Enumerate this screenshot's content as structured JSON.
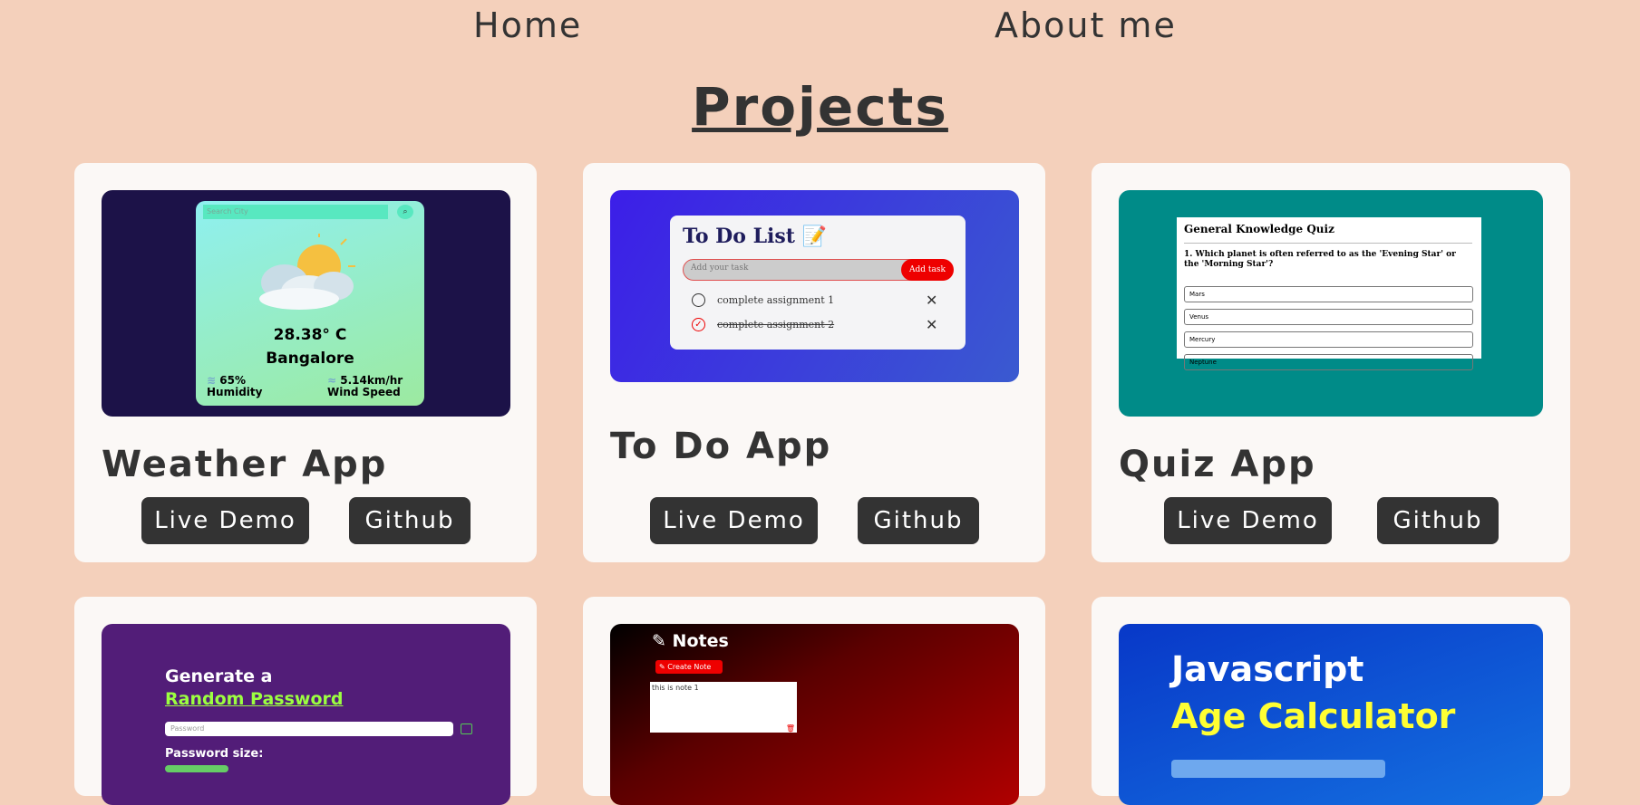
{
  "nav": {
    "home": "Home",
    "about": "About me"
  },
  "page_title": "Projects",
  "projects": [
    {
      "name": "Weather App",
      "live_demo": "Live Demo",
      "github": "Github",
      "preview": {
        "search_placeholder": "Search City",
        "temperature": "28.38° C",
        "city": "Bangalore",
        "humidity_value": "65%",
        "humidity_label": "Humidity",
        "wind_value": "5.14km/hr",
        "wind_label": "Wind Speed"
      }
    },
    {
      "name": "To Do App",
      "live_demo": "Live Demo",
      "github": "Github",
      "preview": {
        "title": "To Do List",
        "input_placeholder": "Add your task",
        "add_button": "Add task",
        "tasks": [
          "complete assignment 1",
          "complete assignment 2"
        ]
      }
    },
    {
      "name": "Quiz App",
      "live_demo": "Live Demo",
      "github": "Github",
      "preview": {
        "heading": "General Knowledge Quiz",
        "question": "1. Which planet is often referred to as the 'Evening Star' or the 'Morning Star'?",
        "options": [
          "Mars",
          "Venus",
          "Mercury",
          "Neptune"
        ]
      }
    },
    {
      "preview": {
        "line1": "Generate a",
        "line2": "Random Password",
        "input_placeholder": "Password",
        "size_label": "Password size:"
      }
    },
    {
      "preview": {
        "title": "Notes",
        "create_button": "Create Note",
        "note_text": "this is note 1"
      }
    },
    {
      "preview": {
        "line1": "Javascript",
        "line2": "Age Calculator"
      }
    }
  ],
  "colors": {
    "background": "#f4d0bb",
    "card": "#fbf8f6",
    "button": "#333333",
    "text": "#333333"
  }
}
